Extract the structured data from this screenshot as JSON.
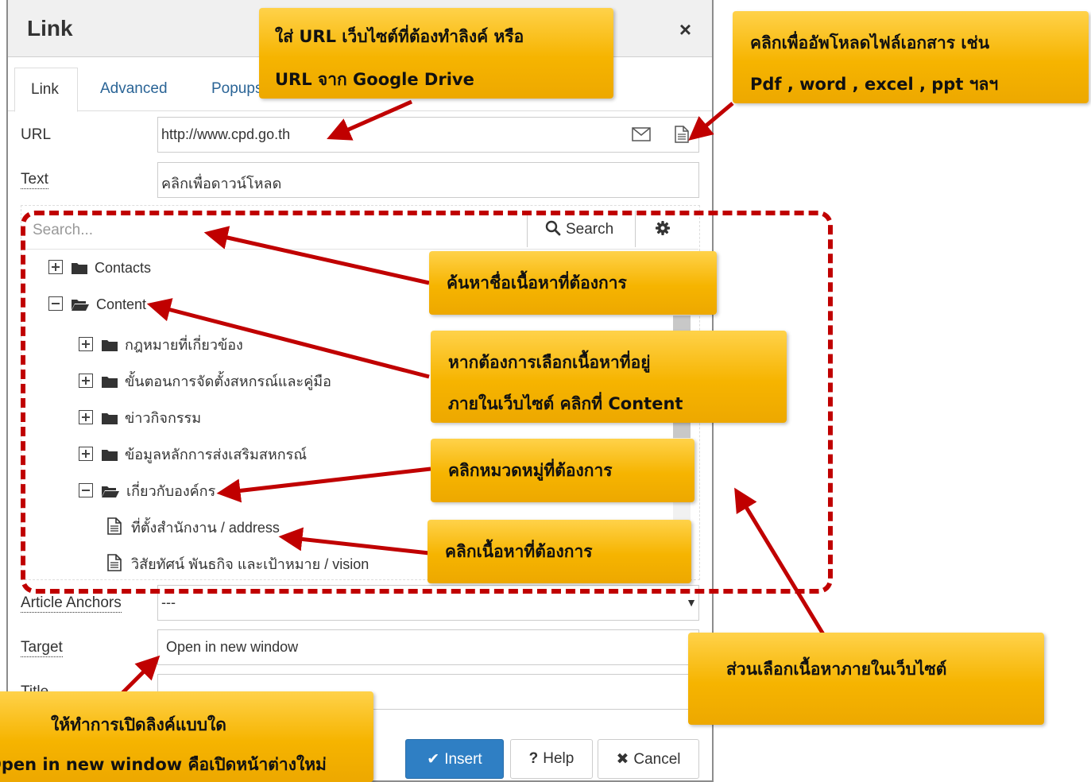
{
  "dialog": {
    "title": "Link",
    "close": "×",
    "tabs": [
      {
        "label": "Link",
        "active": true
      },
      {
        "label": "Advanced",
        "active": false
      },
      {
        "label": "Popups",
        "active": false
      }
    ]
  },
  "form": {
    "url_label": "URL",
    "url_value": "http://www.cpd.go.th",
    "text_label": "Text",
    "text_value": "คลิกเพื่อดาวน์โหลด",
    "anchors_label": "Article Anchors",
    "anchors_value": "---",
    "target_label": "Target",
    "target_value": "Open in new window",
    "title_label": "Title"
  },
  "browser": {
    "search_placeholder": "Search...",
    "search_button": "Search",
    "tree": [
      {
        "label": "Contacts",
        "level": 0,
        "type": "folder",
        "expanded": false
      },
      {
        "label": "Content",
        "level": 0,
        "type": "folder",
        "expanded": true
      },
      {
        "label": "กฎหมายที่เกี่ยวข้อง",
        "level": 1,
        "type": "folder",
        "expanded": false
      },
      {
        "label": "ขั้นตอนการจัดตั้งสหกรณ์และคู่มือ",
        "level": 1,
        "type": "folder",
        "expanded": false
      },
      {
        "label": "ข่าวกิจกรรม",
        "level": 1,
        "type": "folder",
        "expanded": false
      },
      {
        "label": "ข้อมูลหลักการส่งเสริมสหกรณ์",
        "level": 1,
        "type": "folder",
        "expanded": false
      },
      {
        "label": "เกี่ยวกับองค์กร",
        "level": 1,
        "type": "folder",
        "expanded": true
      },
      {
        "label": "ที่ตั้งสำนักงาน / address",
        "level": 2,
        "type": "article"
      },
      {
        "label": "วิสัยทัศน์ พันธกิจ และเป้าหมาย / vision",
        "level": 2,
        "type": "article"
      }
    ]
  },
  "buttons": {
    "insert": "Insert",
    "help": "Help",
    "cancel": "Cancel"
  },
  "annotations": {
    "url_hint": [
      "ใส่ URL เว็บไซต์ที่ต้องทำลิงค์ หรือ",
      "URL จาก Google Drive"
    ],
    "upload_hint": [
      "คลิกเพื่ออัพโหลดไฟล์เอกสาร เช่น",
      "Pdf , word , excel , ppt ฯลฯ"
    ],
    "search_hint": "ค้นหาชื่อเนื้อหาที่ต้องการ",
    "content_hint": [
      "หากต้องการเลือกเนื้อหาที่อยู่",
      "ภายในเว็บไซต์ คลิกที่ Content"
    ],
    "category_hint": "คลิกหมวดหมู่ที่ต้องการ",
    "article_hint": "คลิกเนื้อหาที่ต้องการ",
    "section_hint": "ส่วนเลือกเนื้อหาภายในเว็บไซต์",
    "target_hint": [
      "ให้ทำการเปิดลิงค์แบบใด",
      "Open in new window คือเปิดหน้าต่างใหม่"
    ]
  },
  "colors": {
    "callout": "#f6b400",
    "arrow": "#c00000",
    "primary_button": "#2f7fc4",
    "tab_link": "#2a6496"
  },
  "icons": {
    "url_field": [
      "envelope-icon",
      "file-icon"
    ],
    "tree_folder_collapsed": "folder-icon",
    "tree_folder_expanded": "folder-open-icon",
    "tree_article": "file-text-icon"
  }
}
